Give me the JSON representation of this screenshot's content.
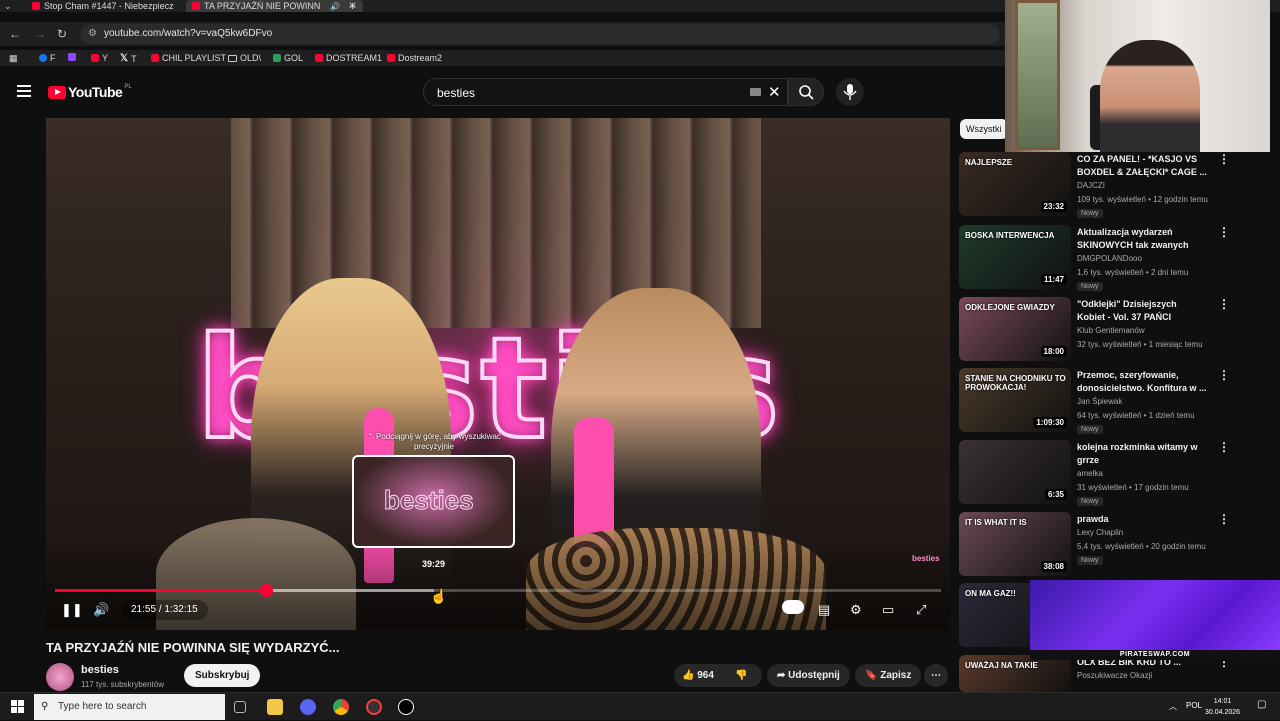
{
  "browser": {
    "tabs": [
      {
        "label": "Stop Cham #1447 - Niebezpiecz",
        "active": false
      },
      {
        "label": "TA PRZYJAŹŃ NIE POWINN",
        "active": true
      }
    ],
    "new_tab_symbol": "+",
    "url": "youtube.com/watch?v=vaQ5kw6DFvo",
    "bookmarks": [
      {
        "label": "F",
        "icon": "facebook-icon",
        "color": "#1877f2"
      },
      {
        "label": "",
        "icon": "twitch-icon",
        "color": "#9146ff"
      },
      {
        "label": "Y",
        "icon": "youtube-icon",
        "color": "#ff0033"
      },
      {
        "label": "T",
        "icon": "x-icon",
        "color": "#ffffff"
      },
      {
        "label": "CHIL PLAYLIST",
        "icon": "youtube-icon",
        "color": "#ff0033"
      },
      {
        "label": "OLD\\",
        "icon": "folder-icon",
        "color": "#cccccc"
      },
      {
        "label": "GOL",
        "icon": "g-icon",
        "color": "#2d9b5a"
      },
      {
        "label": "DOSTREAM1",
        "icon": "youtube-icon",
        "color": "#ff0033"
      },
      {
        "label": "Dostream2",
        "icon": "youtube-icon",
        "color": "#ff0033"
      }
    ]
  },
  "youtube": {
    "logo_text": "YouTube",
    "region": "PL",
    "search_value": "besties"
  },
  "player": {
    "neon_text": "besties",
    "hint_text": "⌃ Podciągnij w górę, aby wyszukiwać precyzyjnie",
    "preview_time": "39:29",
    "time_current": "21:55",
    "time_total": "1:32:15",
    "progress_fraction": 0.238,
    "hover_fraction": 0.428,
    "watermark": "besties"
  },
  "video": {
    "title": "TA PRZYJAŹŃ NIE POWINNA SIĘ WYDARZYĆ...",
    "channel": "besties",
    "subscribers": "117 tys. subskrybentów",
    "subscribe_label": "Subskrybuj",
    "likes": "964",
    "share_label": "Udostępnij",
    "save_label": "Zapisz"
  },
  "sidebar": {
    "chip": "Wszystki",
    "items": [
      {
        "title": "CO ZA PANEL! - *KASJO VS BOXDEL & ZAŁĘCKI* CAGE ...",
        "channel": "DAJCZI",
        "meta": "109 tys. wyświetleń • 12 godzin temu",
        "badge": "Nowy",
        "duration": "23:32",
        "thumb_text": "NAJLEPSZE",
        "thumb_color": "#3a2b22"
      },
      {
        "title": "Aktualizacja wydarzeń SKINOWYCH tak zwanych 🔥...",
        "channel": "DMGPOLANDooo",
        "meta": "1,6 tys. wyświetleń • 2 dni temu",
        "badge": "Nowy",
        "duration": "11:47",
        "thumb_text": "BOSKA INTERWENCJA",
        "thumb_color": "#1f3a2b"
      },
      {
        "title": "\"Odklejki\" Dzisiejszych Kobiet - Vol. 37  PAŃCI POTRZEBNA ...",
        "channel": "Klub Gentlemanów",
        "meta": "32 tys. wyświetleń • 1 miesiąc temu",
        "badge": "",
        "duration": "18:00",
        "thumb_text": "ODKLEJONE GWIAZDY",
        "thumb_color": "#7a4a5a"
      },
      {
        "title": "Przemoc, szeryfowanie, donosicielstwo. Konfitura w ...",
        "channel": "Jan Śpiewak",
        "meta": "64 tys. wyświetleń • 1 dzień temu",
        "badge": "Nowy",
        "duration": "1:09:30",
        "thumb_text": "STANIE NA CHODNIKU TO PROWOKACJA!",
        "thumb_color": "#4a3a2a"
      },
      {
        "title": "kolejna rozkminka witamy w grrze",
        "channel": "amelka",
        "meta": "31 wyświetleń • 17 godzin temu",
        "badge": "Nowy",
        "duration": "6:35",
        "thumb_text": "",
        "thumb_color": "#3a3136"
      },
      {
        "title": "prawda",
        "channel": "Lexy Chaplin",
        "meta": "5,4 tys. wyświetleń • 20 godzin temu",
        "badge": "Nowy",
        "duration": "38:08",
        "thumb_text": "IT IS WHAT IT IS",
        "thumb_color": "#6a4a52"
      },
      {
        "title": "",
        "channel": "",
        "meta": "",
        "badge": "",
        "duration": "",
        "thumb_text": "ON MA GAZ!!",
        "thumb_color": "#2a2a3a"
      },
      {
        "title": "OLX BEZ BIK KRD TO ...",
        "channel": "Poszukiwacze Okazji",
        "meta": "",
        "badge": "",
        "duration": "",
        "thumb_text": "UWAŻAJ NA TAKIE",
        "thumb_color": "#5a3a2a"
      }
    ]
  },
  "overlay": {
    "promo_label": "PIRATESWAP.COM"
  },
  "taskbar": {
    "search_placeholder": "Type here to search",
    "language": "POL",
    "time": "14:01",
    "date": "30.04.2026"
  },
  "colors": {
    "accent": "#ff0033",
    "background": "#0f0f0f"
  }
}
